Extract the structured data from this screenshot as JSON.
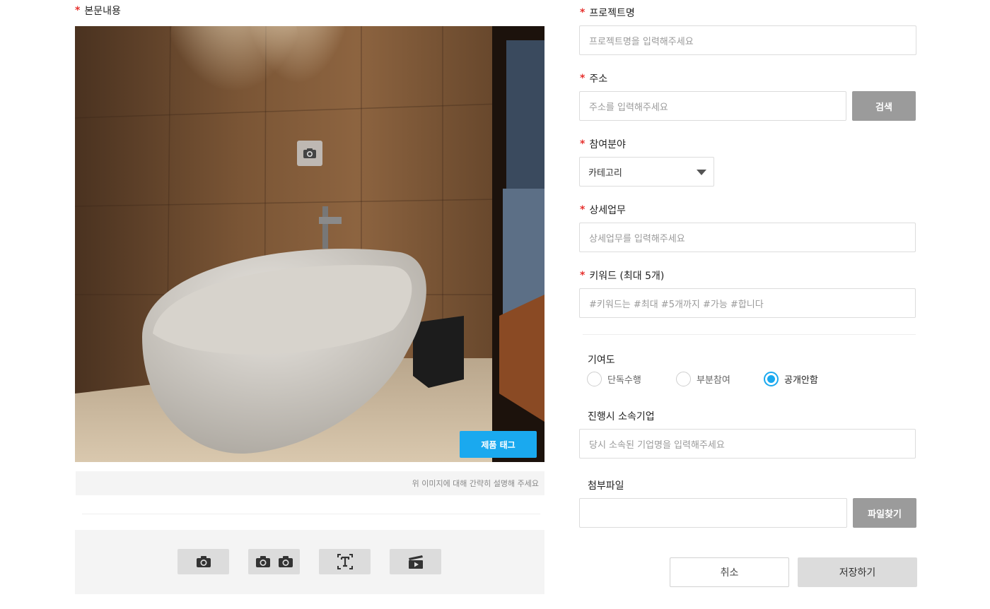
{
  "left": {
    "body_label": "본문내용",
    "tag_button": "제품 태그",
    "caption_placeholder": "위 이미지에 대해 간략히 설명해 주세요",
    "toolbar": {
      "icons": [
        "camera-icon",
        "multi-camera-icon",
        "text-icon",
        "video-icon"
      ]
    }
  },
  "form": {
    "project_name": {
      "label": "프로젝트명",
      "placeholder": "프로젝트명을 입력해주세요"
    },
    "address": {
      "label": "주소",
      "placeholder": "주소를 입력해주세요",
      "button": "검색"
    },
    "field": {
      "label": "참여분야",
      "selected": "카테고리"
    },
    "detail": {
      "label": "상세업무",
      "placeholder": "상세업무를 입력해주세요"
    },
    "keyword": {
      "label": "키워드 (최대 5개)",
      "placeholder": "#키워드는 #최대 #5개까지 #가능 #합니다"
    },
    "contribution": {
      "label": "기여도",
      "options": [
        "단독수행",
        "부분참여",
        "공개안함"
      ],
      "selected": "공개안함"
    },
    "company": {
      "label": "진행시 소속기업",
      "placeholder": "당시 소속된 기업명을 입력해주세요"
    },
    "attachment": {
      "label": "첨부파일",
      "button": "파일찾기"
    },
    "required_mark": "*"
  },
  "actions": {
    "cancel": "취소",
    "save": "저장하기"
  },
  "colors": {
    "accent": "#1aa9ef",
    "required": "#e6312e",
    "button_gray": "#9b9b9b"
  }
}
